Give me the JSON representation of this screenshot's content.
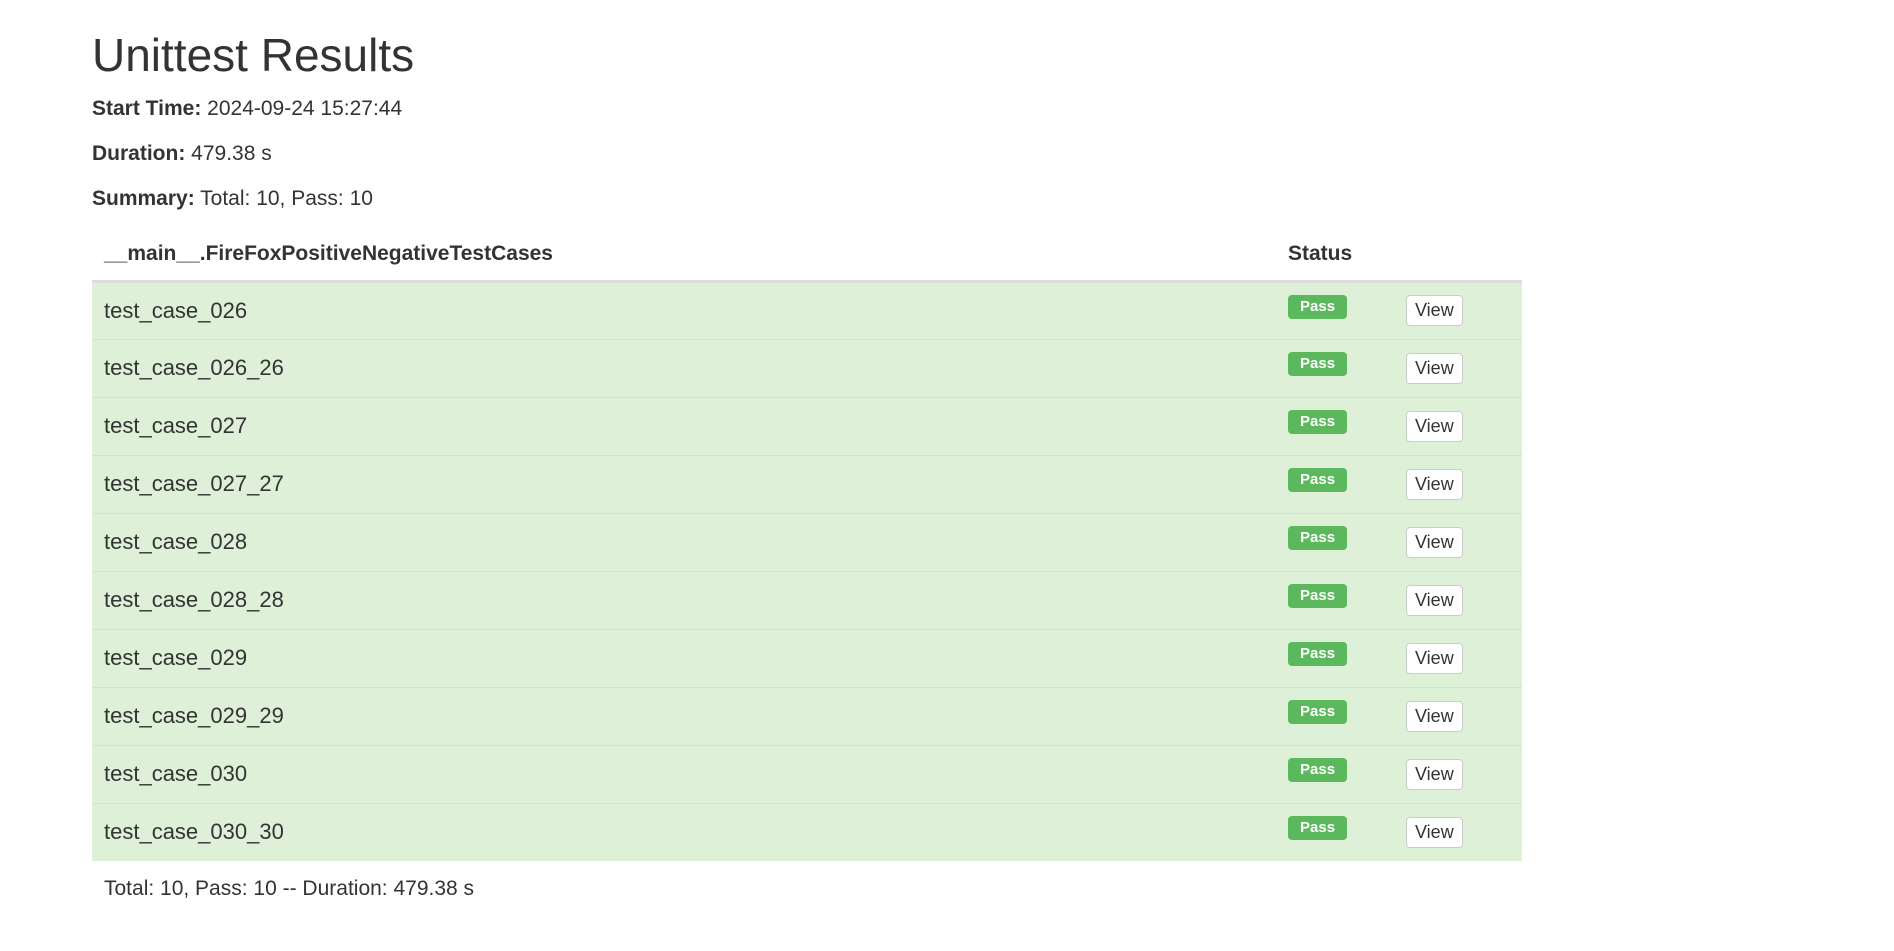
{
  "page": {
    "title": "Unittest Results"
  },
  "meta": {
    "start_time_label": "Start Time:",
    "start_time_value": "2024-09-24 15:27:44",
    "duration_label": "Duration:",
    "duration_value": "479.38 s",
    "summary_label": "Summary:",
    "summary_value": "Total: 10, Pass: 10"
  },
  "table": {
    "headers": {
      "suite": "__main__.FireFoxPositiveNegativeTestCases",
      "status": "Status",
      "action": ""
    },
    "rows": [
      {
        "name": "test_case_026",
        "status": "Pass",
        "action": "View"
      },
      {
        "name": "test_case_026_26",
        "status": "Pass",
        "action": "View"
      },
      {
        "name": "test_case_027",
        "status": "Pass",
        "action": "View"
      },
      {
        "name": "test_case_027_27",
        "status": "Pass",
        "action": "View"
      },
      {
        "name": "test_case_028",
        "status": "Pass",
        "action": "View"
      },
      {
        "name": "test_case_028_28",
        "status": "Pass",
        "action": "View"
      },
      {
        "name": "test_case_029",
        "status": "Pass",
        "action": "View"
      },
      {
        "name": "test_case_029_29",
        "status": "Pass",
        "action": "View"
      },
      {
        "name": "test_case_030",
        "status": "Pass",
        "action": "View"
      },
      {
        "name": "test_case_030_30",
        "status": "Pass",
        "action": "View"
      }
    ],
    "footer": "Total: 10, Pass: 10 -- Duration: 479.38 s"
  },
  "colors": {
    "pass_row_bg": "#dff0d8",
    "pass_badge": "#5cb85c",
    "text": "#333333"
  }
}
